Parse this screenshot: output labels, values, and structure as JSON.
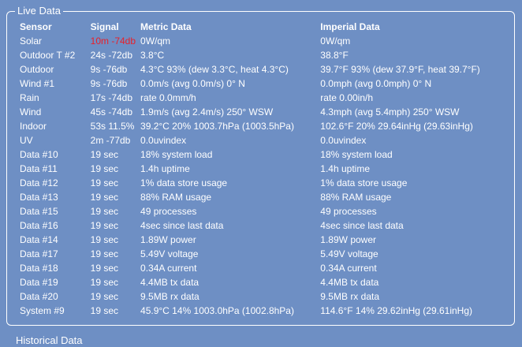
{
  "panel": {
    "title": "Live Data",
    "columns": [
      "Sensor",
      "Signal",
      "Metric Data",
      "Imperial Data"
    ],
    "rows": [
      {
        "sensor": "Solar",
        "signal": "10m -74db",
        "signal_alert": true,
        "metric": "0W/qm",
        "imperial": "0W/qm"
      },
      {
        "sensor": "Outdoor T #2",
        "signal": "24s -72db",
        "metric": "3.8°C",
        "imperial": "38.8°F"
      },
      {
        "sensor": "Outdoor",
        "signal": "9s -76db",
        "metric": "4.3°C 93% (dew 3.3°C, heat 4.3°C)",
        "imperial": "39.7°F 93% (dew 37.9°F, heat 39.7°F)"
      },
      {
        "sensor": "Wind #1",
        "signal": "9s -76db",
        "metric": "0.0m/s (avg 0.0m/s) 0° N",
        "imperial": "0.0mph (avg 0.0mph) 0° N"
      },
      {
        "sensor": "Rain",
        "signal": "17s -74db",
        "metric": "rate 0.0mm/h",
        "imperial": "rate 0.00in/h"
      },
      {
        "sensor": "Wind",
        "signal": "45s -74db",
        "metric": "1.9m/s (avg 2.4m/s) 250° WSW",
        "imperial": "4.3mph (avg 5.4mph) 250° WSW"
      },
      {
        "sensor": "Indoor",
        "signal": "53s 11.5%",
        "metric": "39.2°C 20% 1003.7hPa (1003.5hPa)",
        "imperial": "102.6°F 20% 29.64inHg (29.63inHg)"
      },
      {
        "sensor": "UV",
        "signal": "2m -77db",
        "metric": "0.0uvindex",
        "imperial": "0.0uvindex"
      },
      {
        "sensor": "Data #10",
        "signal": "19 sec",
        "metric": "18% system load",
        "imperial": "18% system load"
      },
      {
        "sensor": "Data #11",
        "signal": "19 sec",
        "metric": "1.4h uptime",
        "imperial": "1.4h uptime"
      },
      {
        "sensor": "Data #12",
        "signal": "19 sec",
        "metric": "1% data store usage",
        "imperial": "1% data store usage"
      },
      {
        "sensor": "Data #13",
        "signal": "19 sec",
        "metric": "88% RAM usage",
        "imperial": "88% RAM usage"
      },
      {
        "sensor": "Data #15",
        "signal": "19 sec",
        "metric": "49 processes",
        "imperial": "49 processes"
      },
      {
        "sensor": "Data #16",
        "signal": "19 sec",
        "metric": "4sec since last data",
        "imperial": "4sec since last data"
      },
      {
        "sensor": "Data #14",
        "signal": "19 sec",
        "metric": "1.89W power",
        "imperial": "1.89W power"
      },
      {
        "sensor": "Data #17",
        "signal": "19 sec",
        "metric": "5.49V voltage",
        "imperial": "5.49V voltage"
      },
      {
        "sensor": "Data #18",
        "signal": "19 sec",
        "metric": "0.34A current",
        "imperial": "0.34A current"
      },
      {
        "sensor": "Data #19",
        "signal": "19 sec",
        "metric": "4.4MB tx data",
        "imperial": "4.4MB tx data"
      },
      {
        "sensor": "Data #20",
        "signal": "19 sec",
        "metric": "9.5MB rx data",
        "imperial": "9.5MB rx data"
      },
      {
        "sensor": "System #9",
        "signal": "19 sec",
        "metric": "45.9°C 14% 1003.0hPa (1002.8hPa)",
        "imperial": "114.6°F 14% 29.62inHg (29.61inHg)"
      }
    ]
  },
  "next_panel": {
    "title": "Historical Data"
  },
  "colors": {
    "background": "#6e8fc4",
    "text": "#ffffff",
    "alert": "#e8202a"
  }
}
